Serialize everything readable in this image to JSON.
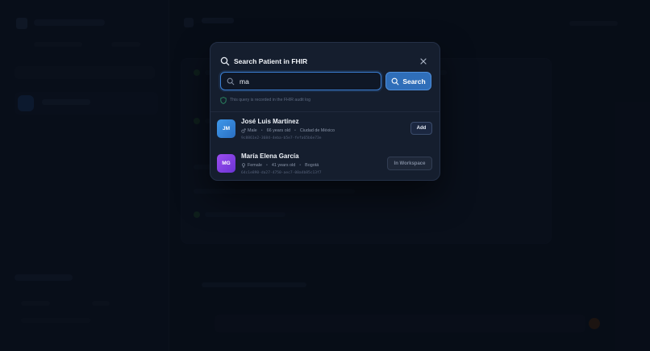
{
  "modal": {
    "title": "Search Patient in FHIR",
    "search": {
      "value": "ma",
      "button_label": "Search"
    },
    "audit_note": "This query is recorded in the FHIR audit log",
    "results": [
      {
        "initials": "JM",
        "name": "José Luis Martínez",
        "gender": "Male",
        "age": "66 years old",
        "city": "Ciudad de México",
        "id": "9c8861e2-3684-4eba-b5e7-fefa65b6e73e",
        "action_label": "Add"
      },
      {
        "initials": "MG",
        "name": "María Elena García",
        "gender": "Female",
        "age": "41 years old",
        "city": "Bogotá",
        "id": "64c1e890-da27-4750-aec7-00a4b85c13f7",
        "action_label": "In Workspace"
      }
    ]
  },
  "colors": {
    "accent": "#2f6eb9",
    "focus_border": "#3b7fd4",
    "avatar_jm": "#3f98ea",
    "avatar_mg": "#9b4df0",
    "audit_shield": "#2c8a63",
    "modal_bg": "#151e2e"
  },
  "icons": {
    "title": "search-icon",
    "close": "close-icon",
    "input": "search-icon",
    "button": "search-icon",
    "audit": "shield-icon",
    "male": "male-icon",
    "female": "female-icon"
  }
}
